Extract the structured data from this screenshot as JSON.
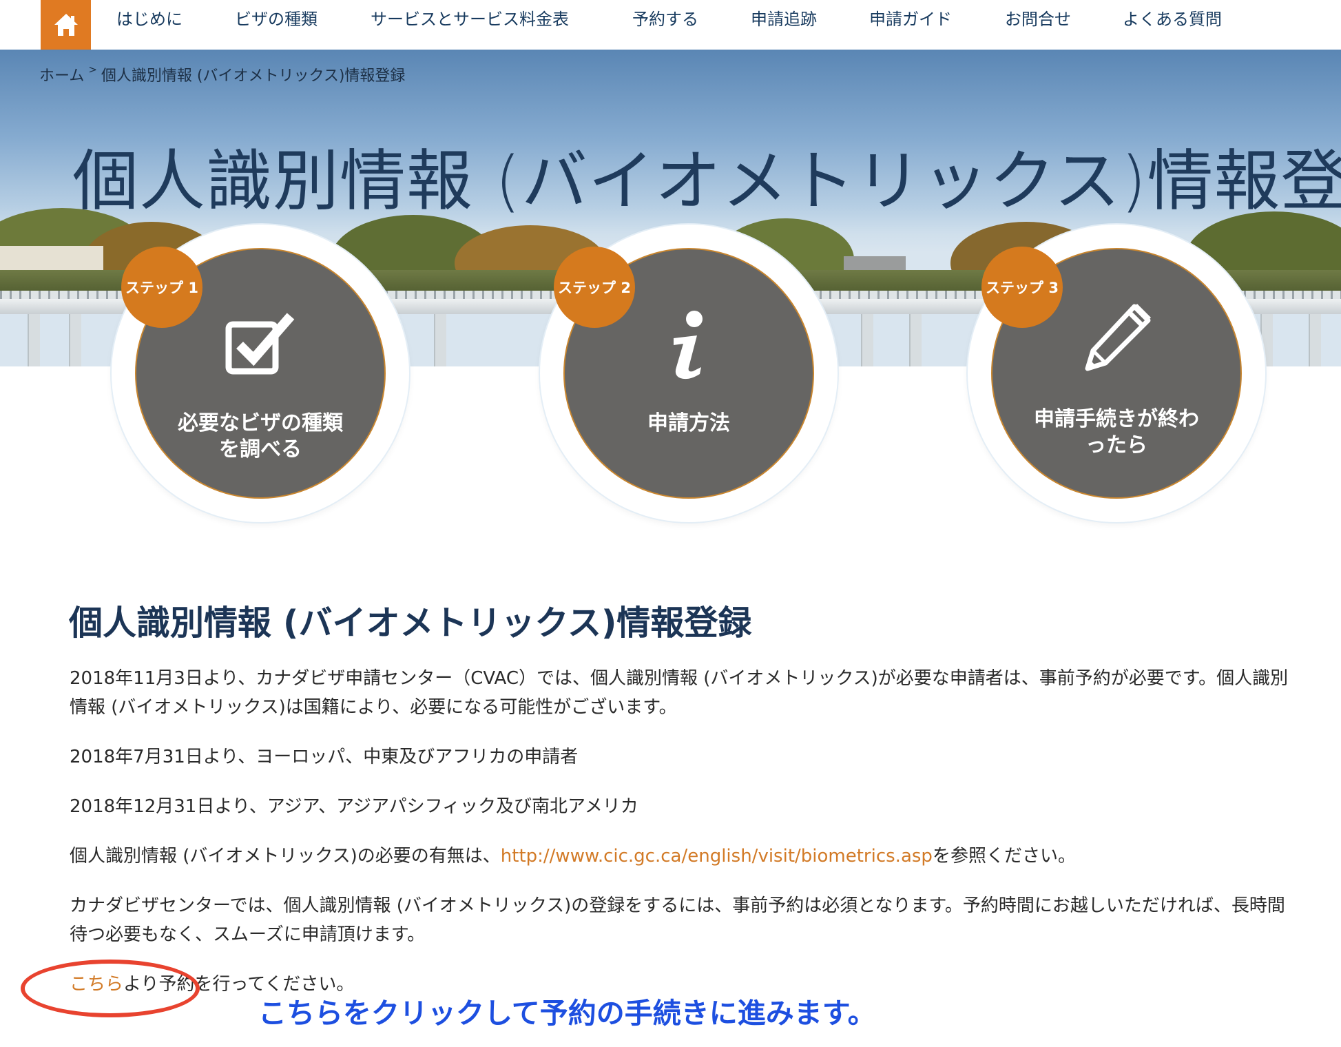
{
  "nav": {
    "home_icon": "home-icon",
    "items": [
      {
        "label": "はじめに"
      },
      {
        "label": "ビザの種類"
      },
      {
        "label": "サービスとサービス料金表"
      },
      {
        "label": "予約する"
      },
      {
        "label": "申請追跡"
      },
      {
        "label": "申請ガイド"
      },
      {
        "label": "お問合せ"
      },
      {
        "label": "よくある質問"
      }
    ]
  },
  "breadcrumb": {
    "home": "ホーム",
    "separator": ">",
    "current": "個人識別情報 (バイオメトリックス)情報登録"
  },
  "hero": {
    "title": "個人識別情報 (バイオメトリックス)情報登"
  },
  "steps": [
    {
      "badge": "ステップ 1",
      "label_line1": "必要なビザの種類",
      "label_line2": "を調べる",
      "icon": "checkbox-icon"
    },
    {
      "badge": "ステップ 2",
      "label_line1": "申請方法",
      "label_line2": "",
      "icon": "info-icon"
    },
    {
      "badge": "ステップ 3",
      "label_line1": "申請手続きが終わ",
      "label_line2": "ったら",
      "icon": "pencil-icon"
    }
  ],
  "content": {
    "title": "個人識別情報 (バイオメトリックス)情報登録",
    "p1": "2018年11月3日より、カナダビザ申請センター（CVAC）では、個人識別情報 (バイオメトリックス)が必要な申請者は、事前予約が必要です。個人識別情報 (バイオメトリックス)は国籍により、必要になる可能性がございます。",
    "p2": "2018年7月31日より、ヨーロッパ、中東及びアフリカの申請者",
    "p3": "2018年12月31日より、アジア、アジアパシフィック及び南北アメリカ",
    "p4_prefix": "個人識別情報 (バイオメトリックス)の必要の有無は、",
    "p4_link": "http://www.cic.gc.ca/english/visit/biometrics.asp",
    "p4_suffix": "を参照ください。",
    "p5": "カナダビザセンターでは、個人識別情報 (バイオメトリックス)の登録をするには、事前予約は必須となります。予約時間にお越しいただければ、長時間待つ必要もなく、スムーズに申請頂けます。",
    "p6_link": "こちら",
    "p6_suffix": "より予約を行ってください。"
  },
  "annotation": {
    "text": "こちらをクリックして予約の手続きに進みます。"
  },
  "colors": {
    "accent_orange": "#e07a22",
    "navy": "#1c3556",
    "step_gray": "#666563",
    "annotation_red": "#e8432f",
    "annotation_blue": "#1d4fe0"
  }
}
